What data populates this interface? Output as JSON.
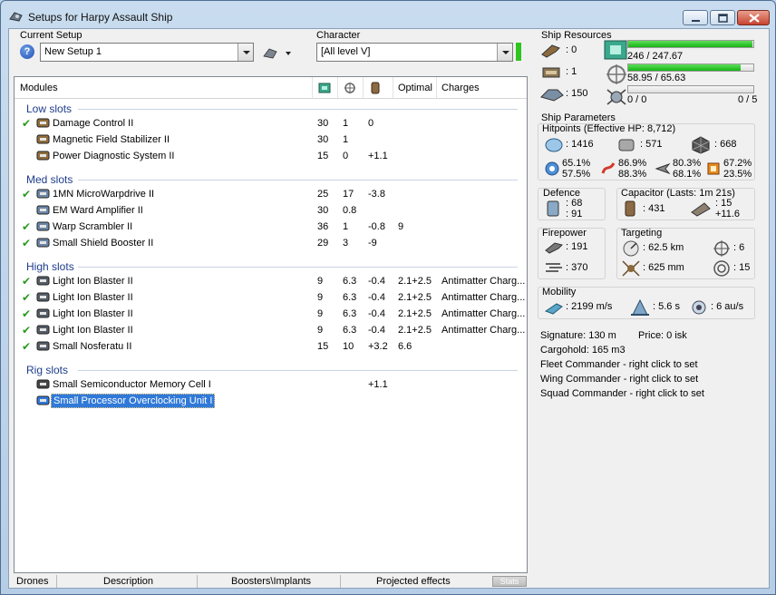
{
  "window": {
    "title": "Setups for Harpy Assault Ship"
  },
  "setup": {
    "label": "Current Setup",
    "value": "New Setup 1"
  },
  "character": {
    "label": "Character",
    "value": "[All level V]"
  },
  "columns": {
    "modules": "Modules",
    "optimal": "Optimal",
    "charges": "Charges"
  },
  "sections": {
    "low": "Low slots",
    "med": "Med slots",
    "high": "High slots",
    "rig": "Rig slots"
  },
  "low": [
    {
      "checked": true,
      "name": "Damage Control II",
      "cpu": "30",
      "pg": "1",
      "cap": "0",
      "optimal": "",
      "charges": ""
    },
    {
      "checked": false,
      "name": "Magnetic Field Stabilizer II",
      "cpu": "30",
      "pg": "1",
      "cap": "",
      "optimal": "",
      "charges": ""
    },
    {
      "checked": false,
      "name": "Power Diagnostic System II",
      "cpu": "15",
      "pg": "0",
      "cap": "+1.1",
      "optimal": "",
      "charges": ""
    }
  ],
  "med": [
    {
      "checked": true,
      "name": "1MN MicroWarpdrive II",
      "cpu": "25",
      "pg": "17",
      "cap": "-3.8",
      "optimal": "",
      "charges": ""
    },
    {
      "checked": false,
      "name": "EM Ward Amplifier II",
      "cpu": "30",
      "pg": "0.8",
      "cap": "",
      "optimal": "",
      "charges": ""
    },
    {
      "checked": true,
      "name": "Warp Scrambler II",
      "cpu": "36",
      "pg": "1",
      "cap": "-0.8",
      "optimal": "9",
      "charges": ""
    },
    {
      "checked": true,
      "name": "Small Shield Booster II",
      "cpu": "29",
      "pg": "3",
      "cap": "-9",
      "optimal": "",
      "charges": ""
    }
  ],
  "high": [
    {
      "checked": true,
      "name": "Light Ion Blaster II",
      "cpu": "9",
      "pg": "6.3",
      "cap": "-0.4",
      "optimal": "2.1+2.5",
      "charges": "Antimatter Charg..."
    },
    {
      "checked": true,
      "name": "Light Ion Blaster II",
      "cpu": "9",
      "pg": "6.3",
      "cap": "-0.4",
      "optimal": "2.1+2.5",
      "charges": "Antimatter Charg..."
    },
    {
      "checked": true,
      "name": "Light Ion Blaster II",
      "cpu": "9",
      "pg": "6.3",
      "cap": "-0.4",
      "optimal": "2.1+2.5",
      "charges": "Antimatter Charg..."
    },
    {
      "checked": true,
      "name": "Light Ion Blaster II",
      "cpu": "9",
      "pg": "6.3",
      "cap": "-0.4",
      "optimal": "2.1+2.5",
      "charges": "Antimatter Charg..."
    },
    {
      "checked": true,
      "name": "Small Nosferatu II",
      "cpu": "15",
      "pg": "10",
      "cap": "+3.2",
      "optimal": "6.6",
      "charges": ""
    }
  ],
  "rig": [
    {
      "checked": false,
      "name": "Small Semiconductor Memory Cell I",
      "cpu": "",
      "pg": "",
      "cap": "+1.1",
      "optimal": "",
      "charges": "",
      "selected": false
    },
    {
      "checked": false,
      "name": "Small Processor Overclocking Unit I",
      "cpu": "",
      "pg": "",
      "cap": "",
      "optimal": "",
      "charges": "",
      "selected": true
    }
  ],
  "tabs": {
    "drones": "Drones",
    "description": "Description",
    "boosters": "Boosters\\Implants",
    "projected": "Projected effects",
    "stats": "Stats"
  },
  "resources": {
    "title": "Ship Resources",
    "turret_hardpoints": ": 0",
    "launcher_hardpoints": ": 1",
    "calibration": ": 150",
    "cpu": "246 / 247.67",
    "cpu_fraction": 0.993,
    "powergrid": "58.95 / 65.63",
    "powergrid_fraction": 0.898,
    "drone_bay": "0 / 0",
    "drone_bay_fraction": 0,
    "drone_bandwidth": "0 / 5"
  },
  "parameters": {
    "title": "Ship Parameters",
    "hitpoints_title": "Hitpoints (Effective HP: 8,712)",
    "shield_hp": ": 1416",
    "armor_hp": ": 571",
    "structure_hp": ": 668",
    "shield_res_a": "65.1%",
    "shield_res_b": "57.5%",
    "armor_res_a": "86.9%",
    "armor_res_b": "88.3%",
    "kin_res_a": "80.3%",
    "kin_res_b": "68.1%",
    "exp_res_a": "67.2%",
    "exp_res_b": "23.5%",
    "defence_title": "Defence",
    "defence_a": ": 68",
    "defence_b": ": 91",
    "capacitor_title": "Capacitor (Lasts: 1m 21s)",
    "capacitor_amount": ": 431",
    "capacitor_delta_a": ": 15",
    "capacitor_delta_b": "+11.6",
    "firepower_title": "Firepower",
    "firepower_a": ": 191",
    "firepower_b": ": 370",
    "targeting_title": "Targeting",
    "targeting_range": ": 62.5 km",
    "max_targets": ": 6",
    "scan_resolution": ": 625 mm",
    "sensor_strength": ": 15",
    "mobility_title": "Mobility",
    "velocity": ": 2199 m/s",
    "align_time": ": 5.6 s",
    "warp_speed": ": 6 au/s",
    "signature": "Signature: 130 m",
    "price": "Price: 0 isk",
    "cargohold": "Cargohold: 165 m3",
    "fleet_commander": "Fleet Commander - right click to set",
    "wing_commander": "Wing Commander - right click to set",
    "squad_commander": "Squad Commander - right click to set"
  }
}
